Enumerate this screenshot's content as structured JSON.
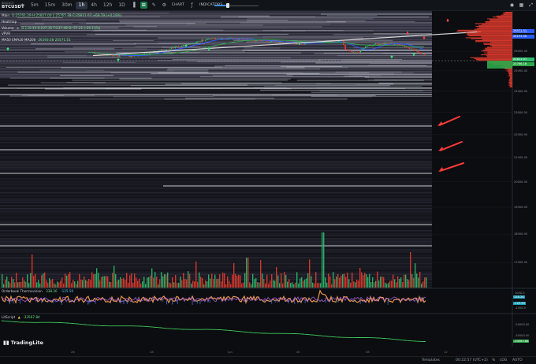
{
  "toolbar": {
    "exchange": "BINANCE",
    "symbol": "BTCUSDT",
    "timeframes": [
      "5m",
      "15m",
      "30m",
      "1h",
      "4h",
      "12h",
      "1D"
    ],
    "active_timeframe": "1h",
    "chart_button": "CHART",
    "indicators_button": "INDICATORS",
    "slider_value": 0.3
  },
  "legend": {
    "main_label": "Main",
    "main_ohlc": "O:25701.29 H:25827.00 L:25765.78 C:25811.07 +69.79 (+0.19%)",
    "heatmap_label": "Heatmap",
    "volume_label": "Volume",
    "volume_values": "B:130.13 S:237.35 T:237.48 D:-57.21 (-26.13%)",
    "vpvr_label": "VPVR",
    "ma_label": "MA50 EMA20 MA200",
    "ma_values": "26193.58 25571.51"
  },
  "price_axis": {
    "ticks": [
      "27000.00",
      "26000.00",
      "25000.00",
      "24000.00",
      "23000.00",
      "22000.00",
      "21000.00",
      "20000.00",
      "19000.00",
      "18000.00",
      "17000.00"
    ],
    "tag_upper": "26571.51",
    "tag_ma": "26193.58",
    "tag_price": "25811.07",
    "tag_green": "25766.18"
  },
  "oscillator": {
    "label": "Orderbook Thermovision",
    "value1": "338.26",
    "value2": "-125.50",
    "axis_ticks": [
      "1000.0",
      "0.0",
      "-1000.0"
    ],
    "tag_a": "338.26",
    "tag_b": "-125.50"
  },
  "litscript": {
    "label": "LitScript",
    "value": "-33567.84",
    "axis_ticks": [
      "-20000.00",
      "-30000.00"
    ],
    "tag": "-33567.84"
  },
  "time_axis": [
    "26",
    "28",
    "Jun",
    "4h",
    "08",
    "12"
  ],
  "logo_text": "TradingLite",
  "status": {
    "templates": "Templates",
    "clock": "00:22:57 (UTC+2)",
    "pct": "%",
    "log": "LOG",
    "auto": "AUTO"
  },
  "colors": {
    "bull": "#2dbd6e",
    "bear": "#e63b2e",
    "annotation": "#ff3b3b",
    "ma_blue": "#2b5cff",
    "ma_green": "#2ea84a",
    "trendline": "#d9d9d9"
  },
  "chart_data": {
    "type": "line",
    "series": [],
    "ylim": [
      16500,
      28200
    ],
    "yscale": "log",
    "x": [
      "26",
      "28",
      "Jun",
      "4h",
      "08",
      "12"
    ]
  }
}
